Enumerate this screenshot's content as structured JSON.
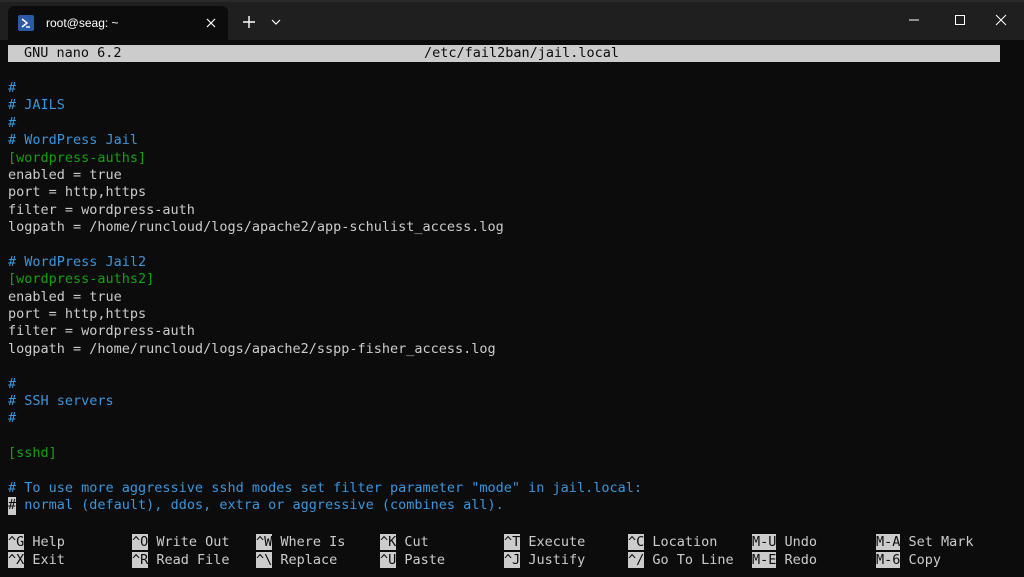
{
  "tab": {
    "title": "root@seag: ~"
  },
  "nano": {
    "version": "GNU nano 6.2",
    "filename": "/etc/fail2ban/jail.local"
  },
  "lines": [
    {
      "text": "#",
      "style": "comment"
    },
    {
      "text": "# JAILS",
      "style": "comment"
    },
    {
      "text": "#",
      "style": "comment"
    },
    {
      "text": "# WordPress Jail",
      "style": "comment"
    },
    {
      "text": "[wordpress-auths]",
      "style": "section"
    },
    {
      "text": "enabled = true",
      "style": "plain"
    },
    {
      "text": "port = http,https",
      "style": "plain"
    },
    {
      "text": "filter = wordpress-auth",
      "style": "plain"
    },
    {
      "text": "logpath = /home/runcloud/logs/apache2/app-schulist_access.log",
      "style": "plain"
    },
    {
      "text": "",
      "style": "plain"
    },
    {
      "text": "# WordPress Jail2",
      "style": "comment"
    },
    {
      "text": "[wordpress-auths2]",
      "style": "section"
    },
    {
      "text": "enabled = true",
      "style": "plain"
    },
    {
      "text": "port = http,https",
      "style": "plain"
    },
    {
      "text": "filter = wordpress-auth",
      "style": "plain"
    },
    {
      "text": "logpath = /home/runcloud/logs/apache2/sspp-fisher_access.log",
      "style": "plain"
    },
    {
      "text": "",
      "style": "plain"
    },
    {
      "text": "#",
      "style": "comment"
    },
    {
      "text": "# SSH servers",
      "style": "comment"
    },
    {
      "text": "#",
      "style": "comment"
    },
    {
      "text": "",
      "style": "plain"
    },
    {
      "text": "[sshd]",
      "style": "section"
    },
    {
      "text": "",
      "style": "plain"
    },
    {
      "text": "# To use more aggressive sshd modes set filter parameter \"mode\" in jail.local:",
      "style": "comment"
    },
    {
      "text": "# normal (default), ddos, extra or aggressive (combines all).",
      "style": "comment",
      "cursor": true
    }
  ],
  "shortcuts": [
    {
      "key": "^G",
      "label": "Help"
    },
    {
      "key": "^X",
      "label": "Exit"
    },
    {
      "key": "^O",
      "label": "Write Out"
    },
    {
      "key": "^R",
      "label": "Read File"
    },
    {
      "key": "^W",
      "label": "Where Is"
    },
    {
      "key": "^\\",
      "label": "Replace"
    },
    {
      "key": "^K",
      "label": "Cut"
    },
    {
      "key": "^U",
      "label": "Paste"
    },
    {
      "key": "^T",
      "label": "Execute"
    },
    {
      "key": "^J",
      "label": "Justify"
    },
    {
      "key": "^C",
      "label": "Location"
    },
    {
      "key": "^/",
      "label": "Go To Line"
    },
    {
      "key": "M-U",
      "label": "Undo"
    },
    {
      "key": "M-E",
      "label": "Redo"
    },
    {
      "key": "M-A",
      "label": "Set Mark"
    },
    {
      "key": "M-6",
      "label": "Copy"
    }
  ],
  "colors": {
    "comment": "#3a96dd",
    "section": "#13a10e",
    "plain": "#cccccc",
    "background": "#0c0c0c",
    "titlebar": "#1f1f1f"
  }
}
